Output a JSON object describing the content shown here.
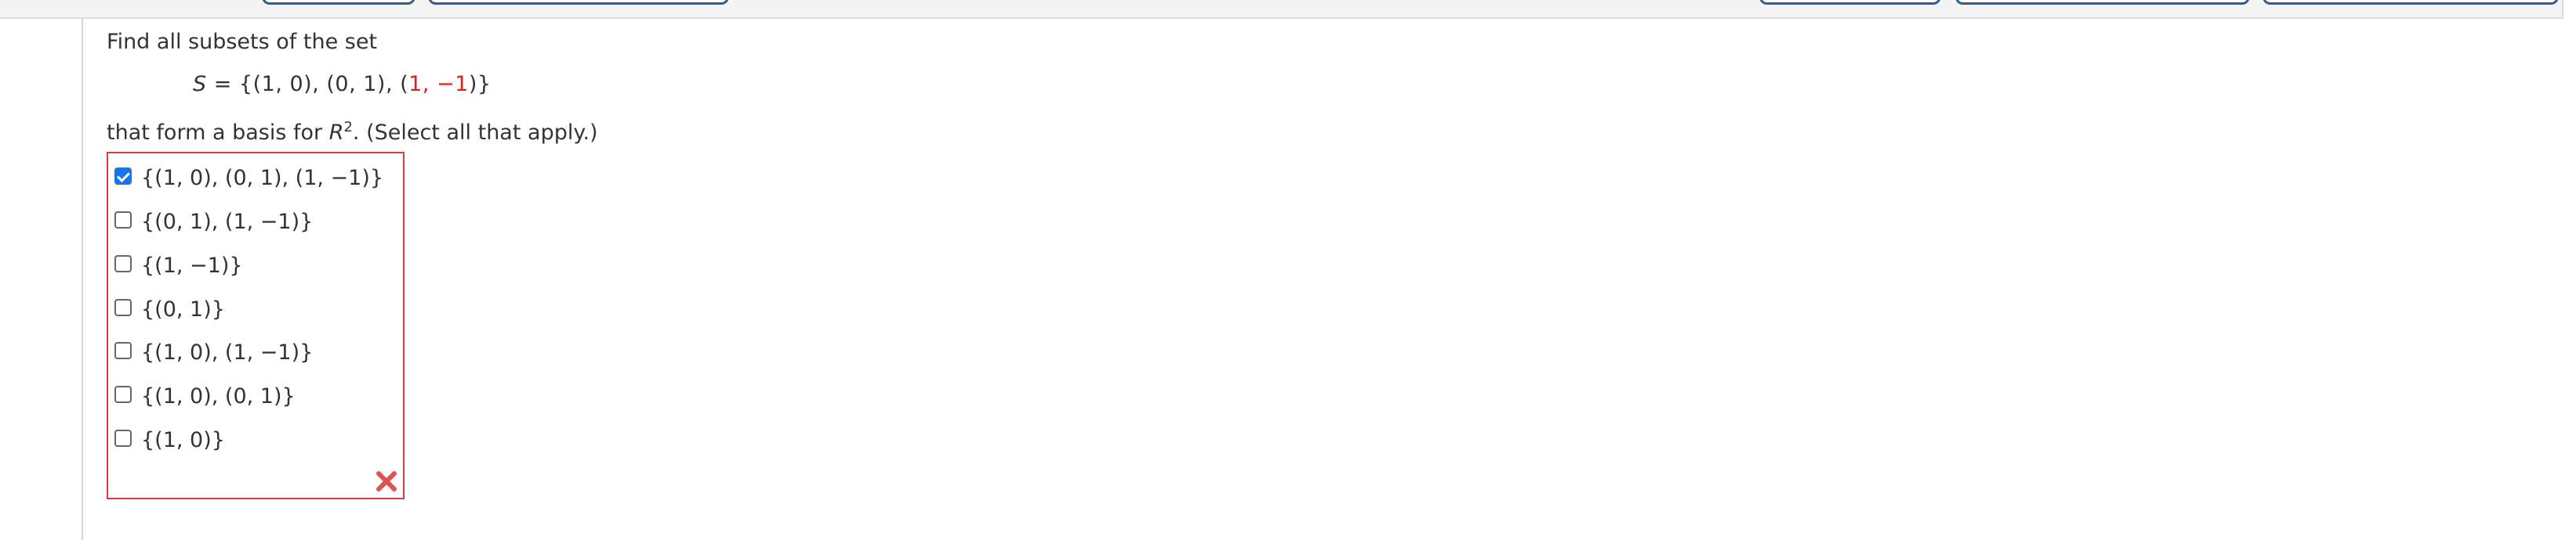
{
  "question": {
    "intro": "Find all subsets of the set",
    "set_lhs": "S",
    "set_eq": " = {(1, 0), (0, 1), (",
    "set_red": "1, −1",
    "set_close": ")}",
    "tail_before": "that form a basis for ",
    "tail_var": "R",
    "tail_exp": "2",
    "tail_after": ". (Select all that apply.)"
  },
  "options": [
    {
      "label": "{(1, 0), (0, 1), (1, −1)}",
      "checked": true
    },
    {
      "label": "{(0, 1), (1, −1)}",
      "checked": false
    },
    {
      "label": "{(1, −1)}",
      "checked": false
    },
    {
      "label": "{(0, 1)}",
      "checked": false
    },
    {
      "label": "{(1, 0), (1, −1)}",
      "checked": false
    },
    {
      "label": "{(1, 0), (0, 1)}",
      "checked": false
    },
    {
      "label": "{(1, 0)}",
      "checked": false
    }
  ],
  "status": {
    "icon": "incorrect-x-icon",
    "color": "#e05252",
    "border_color": "#e0393e"
  },
  "accent_color": "#1a73e8"
}
